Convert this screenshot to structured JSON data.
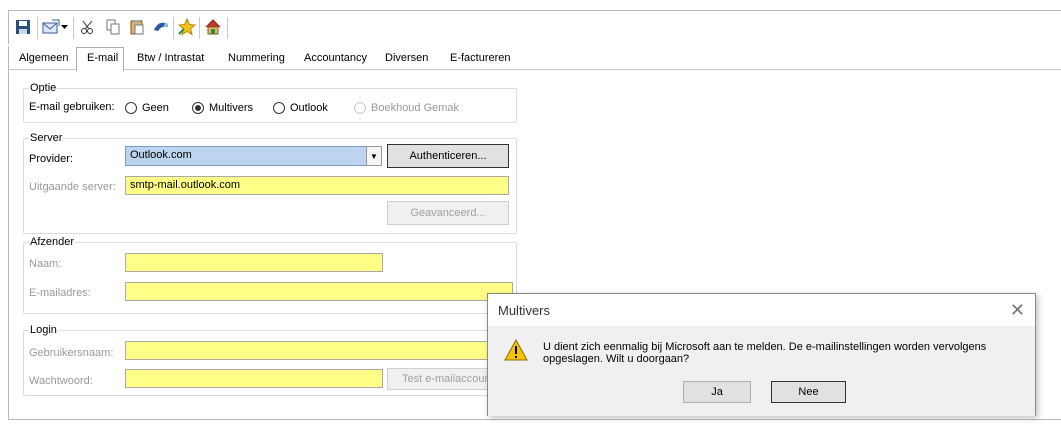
{
  "toolbar": {
    "icons": [
      "save-icon",
      "email-icon",
      "dropdown-arrow-icon",
      "cut-icon",
      "copy-icon",
      "paste-icon",
      "link-icon",
      "star-icon",
      "house-icon"
    ]
  },
  "tabs": [
    "Algemeen",
    "E-mail",
    "Btw / Intrastat",
    "Nummering",
    "Accountancy",
    "Diversen",
    "E-factureren"
  ],
  "active_tab": "E-mail",
  "optie": {
    "title": "Optie",
    "label": "E-mail gebruiken:",
    "options": [
      "Geen",
      "Multivers",
      "Outlook",
      "Boekhoud Gemak"
    ],
    "selected": "Multivers"
  },
  "server": {
    "title": "Server",
    "provider_label": "Provider:",
    "provider_value": "Outlook.com",
    "authenticate_label": "Authenticeren...",
    "outgoing_label": "Uitgaande server:",
    "outgoing_value": "smtp-mail.outlook.com",
    "advanced_label": "Geavanceerd..."
  },
  "afzender": {
    "title": "Afzender",
    "name_label": "Naam:",
    "name_value": "",
    "email_label": "E-mailadres:",
    "email_value": ""
  },
  "login": {
    "title": "Login",
    "username_label": "Gebruikersnaam:",
    "username_value": "",
    "password_label": "Wachtwoord:",
    "password_value": "",
    "test_label": "Test e-mailaccount"
  },
  "dialog": {
    "title": "Multivers",
    "close_icon": "close-icon",
    "message": "U dient zich eenmalig bij Microsoft aan te melden. De e-mailinstellingen worden vervolgens opgeslagen. Wilt u doorgaan?",
    "icon": "warning-icon",
    "yes_label": "Ja",
    "no_label": "Nee"
  },
  "colors": {
    "field_yellow": "#ffff88",
    "combo_blue": "#bcd4ee",
    "warning_yellow": "#f5c400"
  }
}
